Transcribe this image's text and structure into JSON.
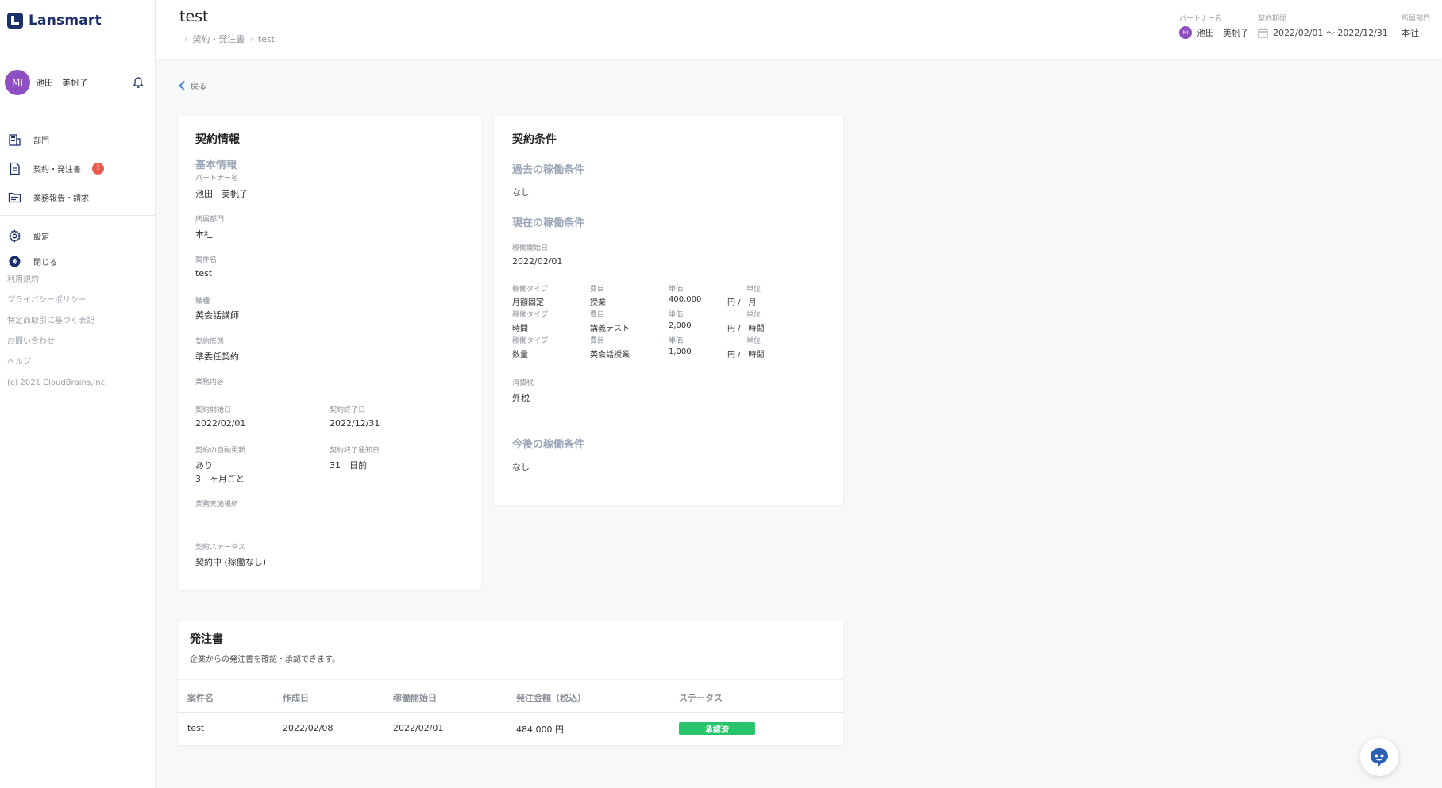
{
  "app": {
    "logo_text": "Lansmart"
  },
  "user": {
    "initials": "MI",
    "name": "池田　美帆子"
  },
  "sidebar": {
    "items": [
      {
        "label": "部門"
      },
      {
        "label": "契約・発注書",
        "badge": "!"
      },
      {
        "label": "業務報告・請求"
      }
    ],
    "settings_label": "設定",
    "close_label": "閉じる",
    "footer_links": [
      "利用規約",
      "プライバシーポリシー",
      "特定商取引に基づく表記",
      "お問い合わせ",
      "ヘルプ",
      "(c) 2021 CloudBrains,Inc."
    ]
  },
  "header": {
    "title": "test",
    "breadcrumb": [
      "契約・発注書",
      "test"
    ],
    "partner_label": "パートナー名",
    "partner_initials": "MI",
    "partner_name": "池田　美帆子",
    "period_label": "契約期間",
    "period_value": "2022/02/01 〜 2022/12/31",
    "dept_label": "所属部門",
    "dept_value": "本社"
  },
  "back_label": "戻る",
  "contract_info": {
    "title": "契約情報",
    "section": "基本情報",
    "partner_label": "パートナー名",
    "partner_value": "池田　美帆子",
    "dept_label": "所属部門",
    "dept_value": "本社",
    "project_label": "案件名",
    "project_value": "test",
    "job_label": "職種",
    "job_value": "英会話講師",
    "form_label": "契約形態",
    "form_value": "準委任契約",
    "content_label": "業務内容",
    "start_label": "契約開始日",
    "start_value": "2022/02/01",
    "end_label": "契約終了日",
    "end_value": "2022/12/31",
    "renew_label": "契約の自動更新",
    "renew_value": "あり",
    "renew_cycle": "3　ヶ月ごと",
    "notice_label": "契約終了通知日",
    "notice_value": "31　日前",
    "place_label": "業務実施場所",
    "status_label": "契約ステータス",
    "status_value": "契約中 (稼働なし)"
  },
  "contract_terms": {
    "title": "契約条件",
    "past_title": "過去の稼働条件",
    "past_value": "なし",
    "current_title": "現在の稼働条件",
    "current_start_label": "稼働開始日",
    "current_start_value": "2022/02/01",
    "col_type": "稼働タイプ",
    "col_item": "費目",
    "col_price": "単価",
    "col_unit": "単位",
    "rows": [
      {
        "type": "月額固定",
        "item": "授業",
        "price": "400,000",
        "unit": "円 /　月"
      },
      {
        "type": "時間",
        "item": "講義テスト",
        "price": "2,000",
        "unit": "円 /　時間"
      },
      {
        "type": "数量",
        "item": "英会話授業",
        "price": "1,000",
        "unit": "円 /　時間"
      }
    ],
    "tax_label": "消費税",
    "tax_value": "外税",
    "future_title": "今後の稼働条件",
    "future_value": "なし"
  },
  "orders": {
    "title": "発注書",
    "description": "企業からの発注書を確認・承認できます。",
    "columns": [
      "案件名",
      "作成日",
      "稼働開始日",
      "発注金額（税込）",
      "ステータス"
    ],
    "row": {
      "project": "test",
      "created": "2022/02/08",
      "start": "2022/02/01",
      "amount": "484,000 円",
      "status": "承認済"
    }
  },
  "colors": {
    "brand": "#1b2f6b",
    "avatar": "#8e4fc2",
    "badge": "#ea5a4f",
    "approved": "#27c46b",
    "accent_blue": "#2b7de9"
  }
}
